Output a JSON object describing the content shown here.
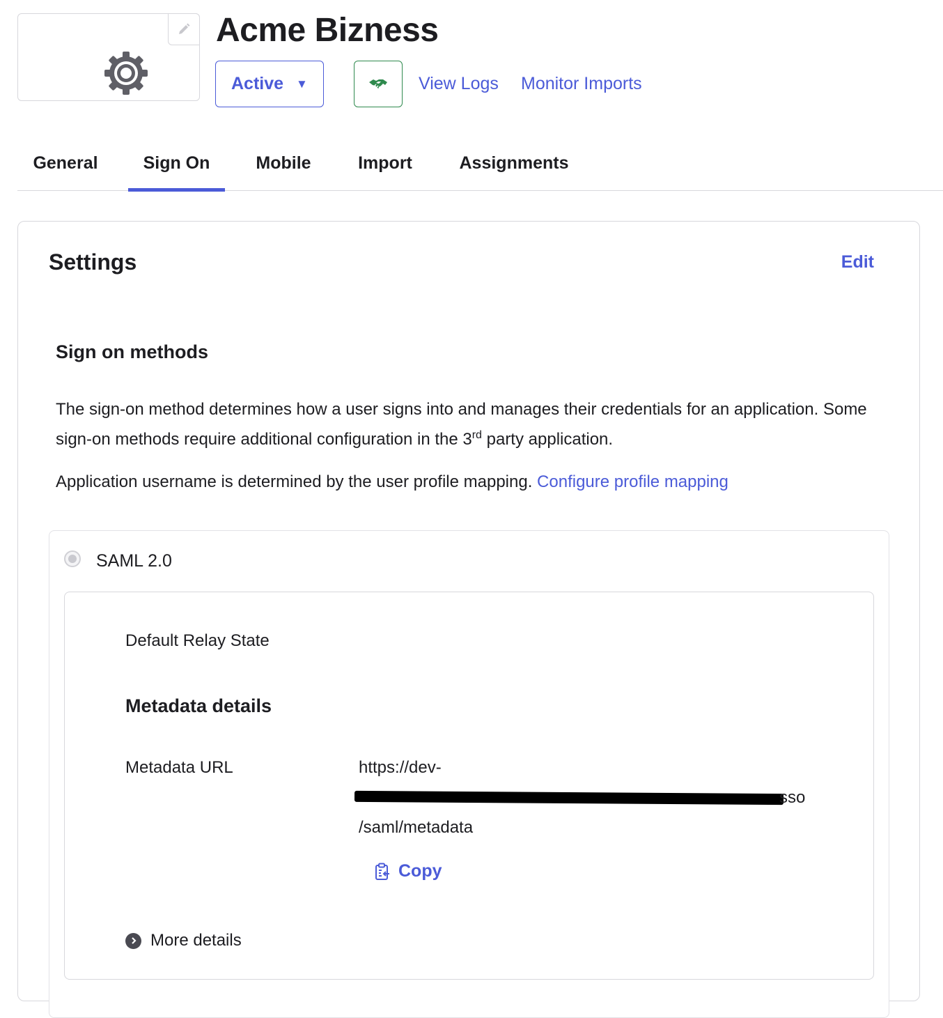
{
  "app": {
    "title": "Acme Bizness",
    "status_label": "Active",
    "status_caret": "▼",
    "logo_icon": "gear-icon",
    "edit_logo_icon": "pencil-icon",
    "push_icon": "handshake-icon",
    "links": {
      "view_logs": "View Logs",
      "monitor_imports": "Monitor Imports"
    }
  },
  "tabs": [
    {
      "label": "General",
      "active": false
    },
    {
      "label": "Sign On",
      "active": true
    },
    {
      "label": "Mobile",
      "active": false
    },
    {
      "label": "Import",
      "active": false
    },
    {
      "label": "Assignments",
      "active": false
    }
  ],
  "settings": {
    "title": "Settings",
    "edit_label": "Edit",
    "sign_on_methods": {
      "title": "Sign on methods",
      "description_part1": "The sign-on method determines how a user signs into and manages their credentials for an application. Some sign-on methods require additional configuration in the 3",
      "description_sup": "rd",
      "description_part2": " party application.",
      "username_text": "Application username is determined by the user profile mapping.",
      "configure_link": "Configure profile mapping"
    },
    "method": {
      "label": "SAML 2.0",
      "selected": true,
      "default_relay_state_label": "Default Relay State",
      "metadata_title": "Metadata details",
      "metadata_url_label": "Metadata URL",
      "metadata_url_line1": "https://dev-",
      "metadata_url_line2_tail": "sso",
      "metadata_url_line3": "/saml/metadata",
      "copy_label": "Copy",
      "copy_icon": "clipboard-icon",
      "more_details_label": "More details",
      "more_details_icon": "chevron-right-icon"
    }
  },
  "colors": {
    "accent": "#4b5bd8",
    "success": "#2f8a4e",
    "border": "#d7d7dc",
    "text": "#1d1d21"
  }
}
